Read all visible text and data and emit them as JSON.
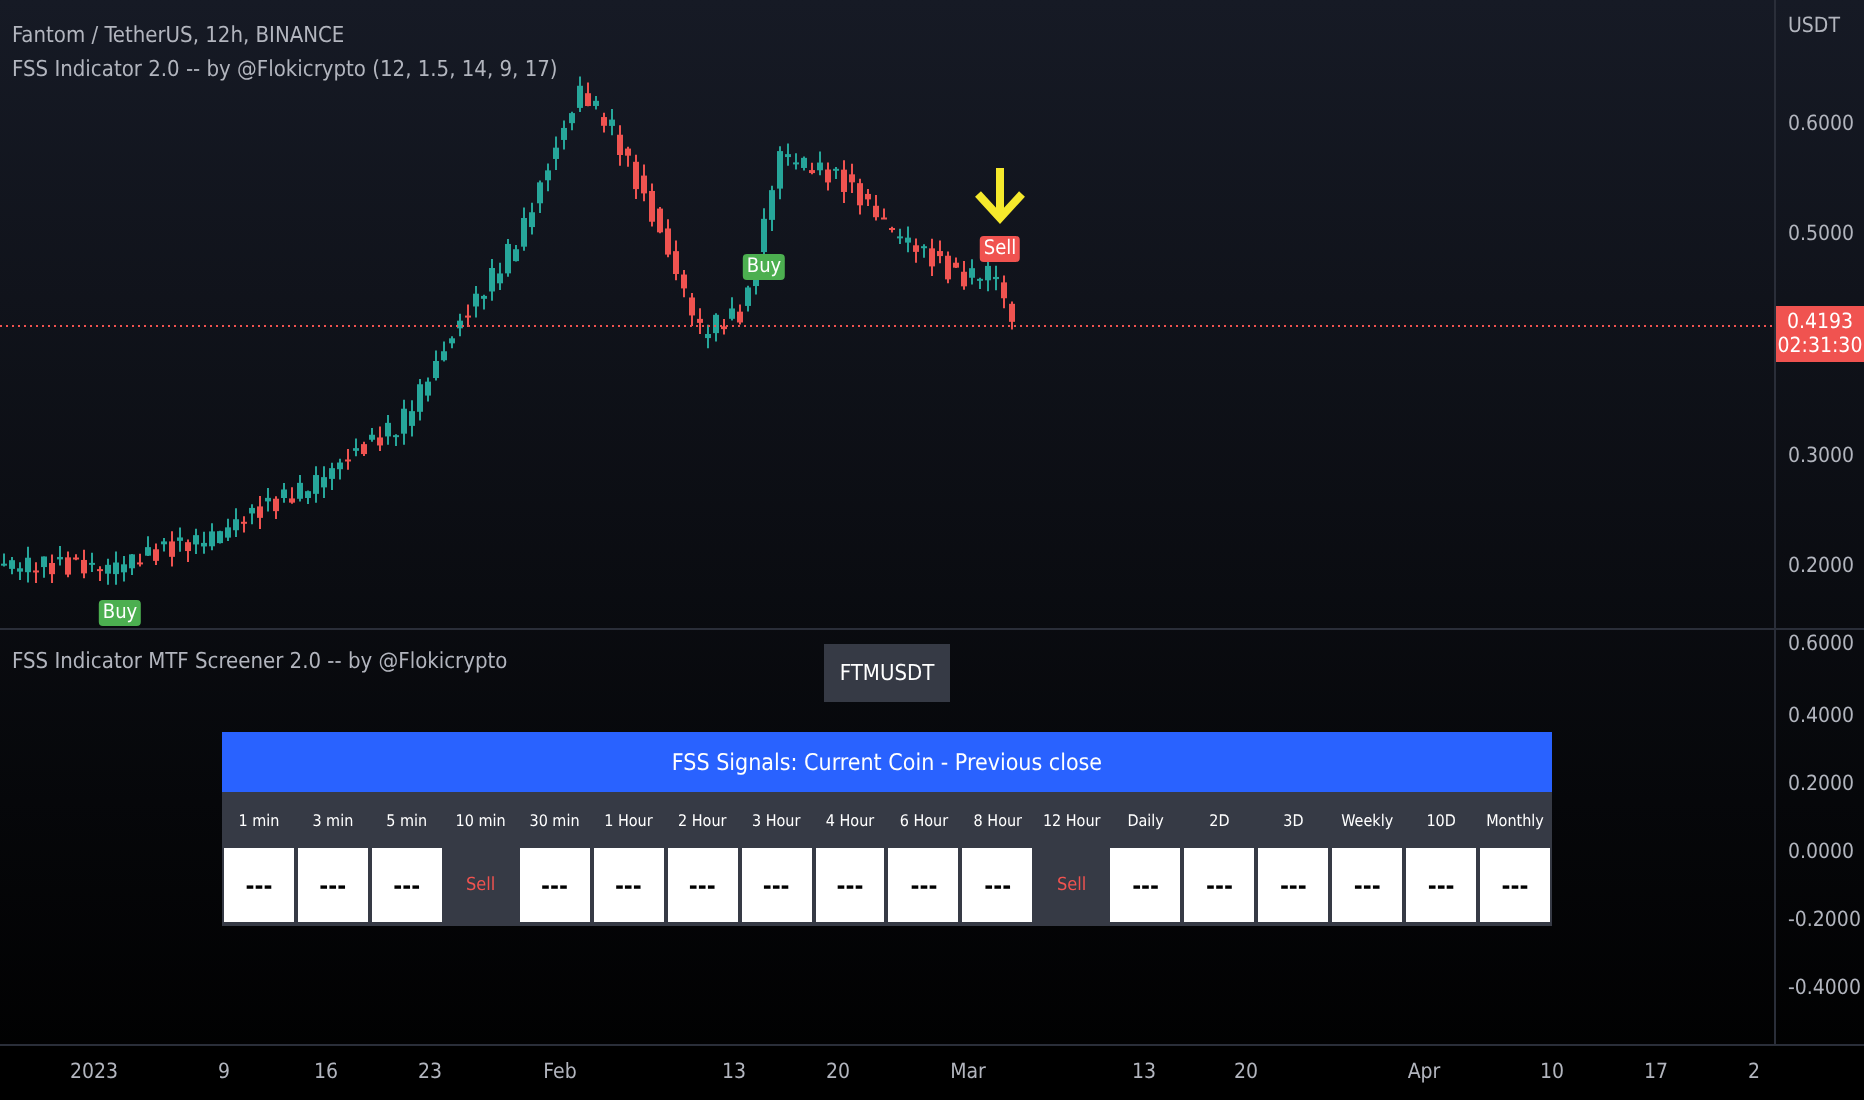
{
  "symbol_legend": "Fantom / TetherUS, 12h, BINANCE",
  "indicator_legend": "FSS Indicator 2.0 -- by @Flokicrypto (12, 1.5, 14, 9, 17)",
  "price_axis": {
    "currency": "USDT",
    "ticks": [
      "0.6000",
      "0.5000",
      "0.3000",
      "0.2000"
    ],
    "last_price": "0.4193",
    "countdown": "02:31:30"
  },
  "signals": [
    {
      "kind": "buy",
      "label": "Buy"
    },
    {
      "kind": "buy",
      "label": "Buy"
    },
    {
      "kind": "sell",
      "label": "Sell"
    }
  ],
  "screener": {
    "legend": "FSS Indicator MTF Screener 2.0 -- by @Flokicrypto",
    "symbol": "FTMUSDT",
    "title": "FSS Signals: Current Coin - Previous close",
    "columns": [
      {
        "label": "1 min",
        "kind": "none",
        "value": "---"
      },
      {
        "label": "3 min",
        "kind": "none",
        "value": "---"
      },
      {
        "label": "5 min",
        "kind": "none",
        "value": "---"
      },
      {
        "label": "10 min",
        "kind": "sell",
        "value": "Sell"
      },
      {
        "label": "30 min",
        "kind": "none",
        "value": "---"
      },
      {
        "label": "1 Hour",
        "kind": "none",
        "value": "---"
      },
      {
        "label": "2 Hour",
        "kind": "none",
        "value": "---"
      },
      {
        "label": "3 Hour",
        "kind": "none",
        "value": "---"
      },
      {
        "label": "4 Hour",
        "kind": "none",
        "value": "---"
      },
      {
        "label": "6 Hour",
        "kind": "none",
        "value": "---"
      },
      {
        "label": "8 Hour",
        "kind": "none",
        "value": "---"
      },
      {
        "label": "12 Hour",
        "kind": "sell",
        "value": "Sell"
      },
      {
        "label": "Daily",
        "kind": "none",
        "value": "---"
      },
      {
        "label": "2D",
        "kind": "none",
        "value": "---"
      },
      {
        "label": "3D",
        "kind": "none",
        "value": "---"
      },
      {
        "label": "Weekly",
        "kind": "none",
        "value": "---"
      },
      {
        "label": "10D",
        "kind": "none",
        "value": "---"
      },
      {
        "label": "Monthly",
        "kind": "none",
        "value": "---"
      }
    ],
    "axis_ticks": [
      "0.6000",
      "0.4000",
      "0.2000",
      "0.0000",
      "-0.2000",
      "-0.4000"
    ]
  },
  "time_axis": [
    "2023",
    "9",
    "16",
    "23",
    "Feb",
    "13",
    "20",
    "Mar",
    "13",
    "20",
    "Apr",
    "10",
    "17",
    "2"
  ]
}
